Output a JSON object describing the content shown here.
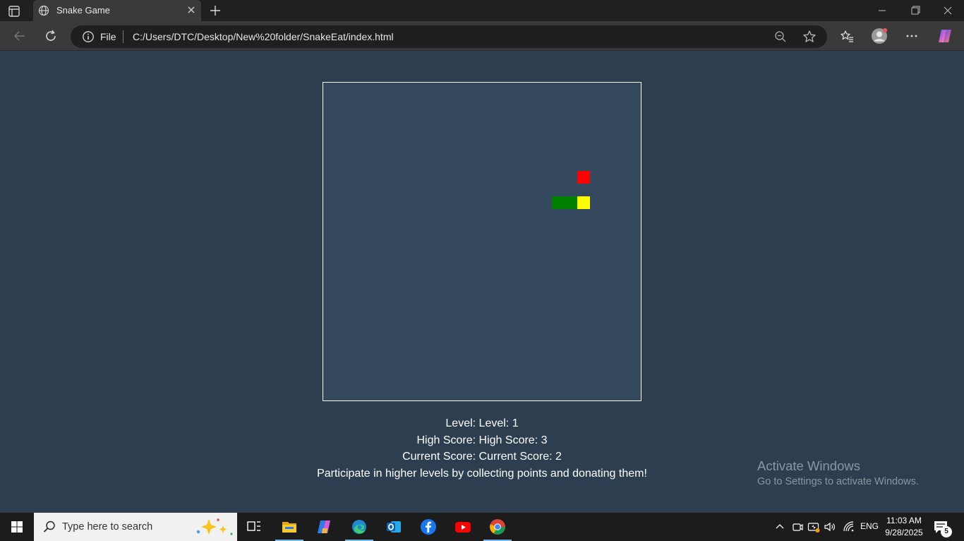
{
  "browser": {
    "tab_title": "Snake Game",
    "url_scheme": "File",
    "url": "C:/Users/DTC/Desktop/New%20folder/SnakeEat/index.html"
  },
  "game": {
    "level_line": "Level: Level: 1",
    "high_score_line": "High Score: High Score: 3",
    "current_score_line": "Current Score: Current Score: 2",
    "message": "Participate in higher levels by collecting points and donating them!",
    "colors": {
      "background": "#2c3e50",
      "board": "#34495e",
      "food": "#ff0000",
      "snake_body": "#008000",
      "snake_head": "#ffff00"
    }
  },
  "watermark": {
    "title": "Activate Windows",
    "subtitle": "Go to Settings to activate Windows."
  },
  "taskbar": {
    "search_placeholder": "Type here to search",
    "apps": [
      "task-view",
      "file-explorer",
      "copilot",
      "edge",
      "outlook",
      "facebook",
      "youtube",
      "chrome"
    ],
    "language": "ENG",
    "time": "11:03 AM",
    "date": "9/28/2025",
    "notification_count": "5"
  }
}
